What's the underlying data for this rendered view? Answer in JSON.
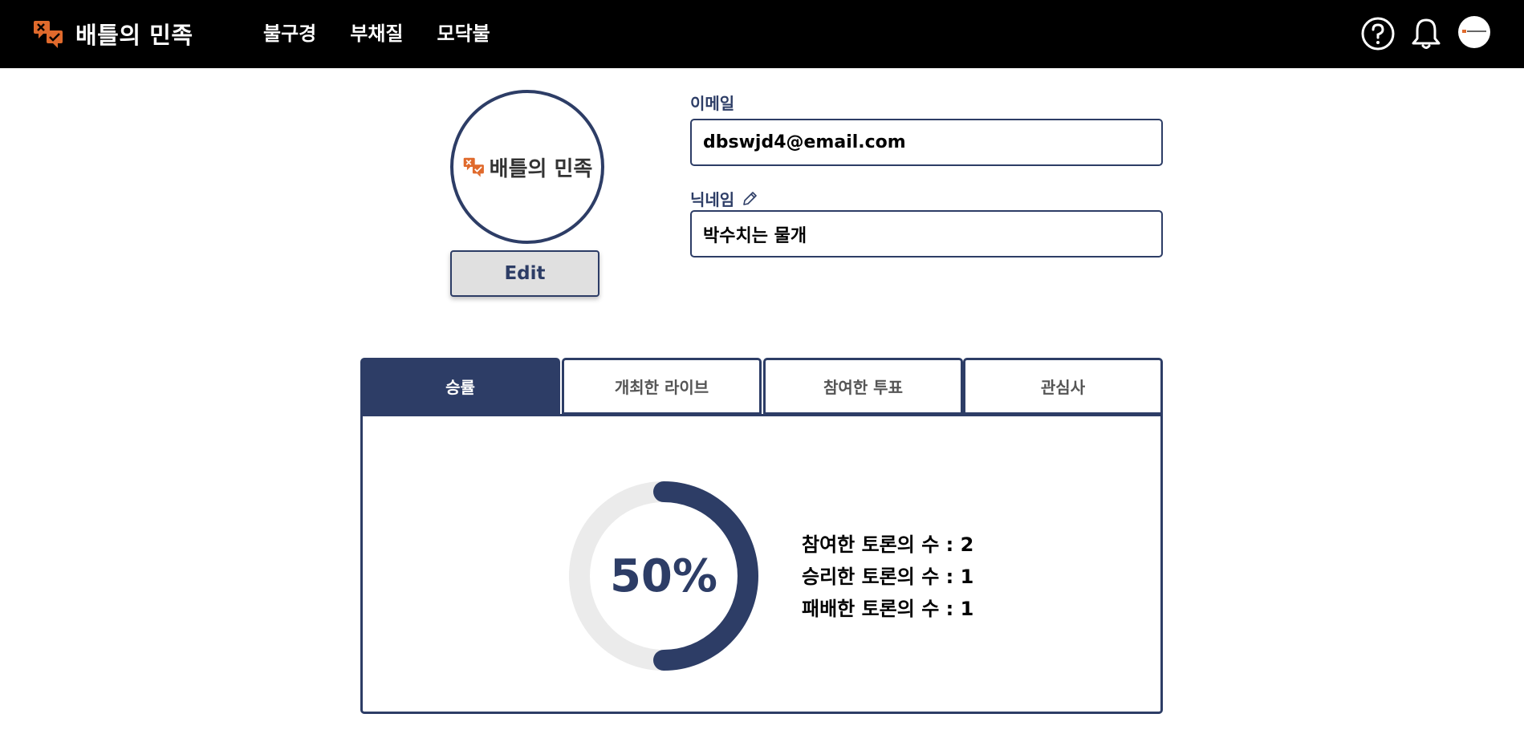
{
  "header": {
    "brand": "배틀의 민족",
    "nav": [
      "불구경",
      "부채질",
      "모닥불"
    ],
    "icons": {
      "help": "help-circle-icon",
      "bell": "bell-icon",
      "avatar": "avatar"
    }
  },
  "profile": {
    "image_text": "배틀의 민족",
    "edit_label": "Edit",
    "email_label": "이메일",
    "email_value": "dbswjd4@email.com",
    "nickname_label": "닉네임",
    "nickname_value": "박수치는 물개"
  },
  "tabs": [
    "승률",
    "개최한 라이브",
    "참여한 투표",
    "관심사"
  ],
  "active_tab": 0,
  "stats": {
    "win_rate_text": "50%",
    "win_rate": 0.5,
    "lines": [
      "참여한 토론의 수 : 2",
      "승리한 토론의 수 : 1",
      "패배한 토론의 수 : 1"
    ]
  },
  "colors": {
    "accent": "#2d3d66",
    "logo_orange": "#e06a2c",
    "track": "#ebebeb"
  }
}
